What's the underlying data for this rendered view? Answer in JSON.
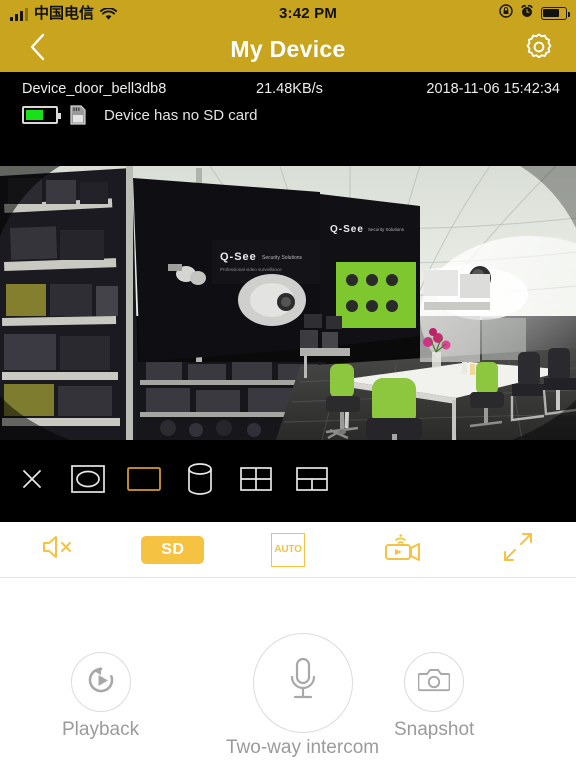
{
  "status_bar": {
    "carrier": "中国电信",
    "time": "3:42 PM",
    "signal_icon": "signal-bars-icon",
    "wifi_icon": "wifi-icon",
    "rotation_lock_icon": "rotation-lock-icon",
    "alarm_icon": "alarm-clock-icon",
    "battery_icon": "battery-icon",
    "battery_level_percent": 72,
    "background_color": "#c9a51f"
  },
  "nav_bar": {
    "title": "My Device",
    "back_icon": "chevron-left-icon",
    "settings_icon": "gear-icon",
    "background_color": "#c9a51f",
    "title_color": "#ffffff"
  },
  "device_info": {
    "name": "Device_door_bell3db8",
    "bitrate": "21.48KB/s",
    "timestamp": "2018-11-06 15:42:34",
    "battery_icon": "battery-icon",
    "battery_level_percent": 60,
    "battery_color": "#19e019",
    "sdcard_icon": "sd-card-icon",
    "sd_status": "Device has no SD card",
    "background_color": "#000000"
  },
  "video": {
    "scene_description": "Fisheye camera view of an electronics store interior with Q-See branded display shelves and an office area with white tables and green office chairs",
    "brand_sign_1": "Q-See",
    "brand_sign_2": "Q-See"
  },
  "view_modes": {
    "items": [
      {
        "name": "close",
        "icon": "close-x-icon",
        "active": false
      },
      {
        "name": "fisheye-view",
        "icon": "fisheye-oval-icon",
        "active": false
      },
      {
        "name": "panorama-view",
        "icon": "rectangle-icon",
        "active": true
      },
      {
        "name": "cylinder-view",
        "icon": "cylinder-icon",
        "active": false
      },
      {
        "name": "quad-view",
        "icon": "grid-2x2-icon",
        "active": false
      },
      {
        "name": "split-view",
        "icon": "split-1plus2-icon",
        "active": false
      }
    ],
    "active_color": "#d49a2a",
    "inactive_color": "#e8e8e8"
  },
  "controls": {
    "accent_color": "#f5c242",
    "items": [
      {
        "name": "mute",
        "icon": "speaker-mute-icon",
        "label": ""
      },
      {
        "name": "quality",
        "icon": "sd-badge",
        "label": "SD",
        "active": true
      },
      {
        "name": "auto-quality",
        "icon": "auto-box-icon",
        "label": "AUTO"
      },
      {
        "name": "record",
        "icon": "camcorder-wifi-icon",
        "label": ""
      },
      {
        "name": "fullscreen",
        "icon": "expand-arrows-icon",
        "label": ""
      }
    ]
  },
  "actions": {
    "playback": {
      "label": "Playback",
      "icon": "replay-play-icon"
    },
    "intercom": {
      "label": "Two-way intercom",
      "icon": "microphone-icon"
    },
    "snapshot": {
      "label": "Snapshot",
      "icon": "camera-icon"
    },
    "label_color": "#9b9b9b"
  }
}
